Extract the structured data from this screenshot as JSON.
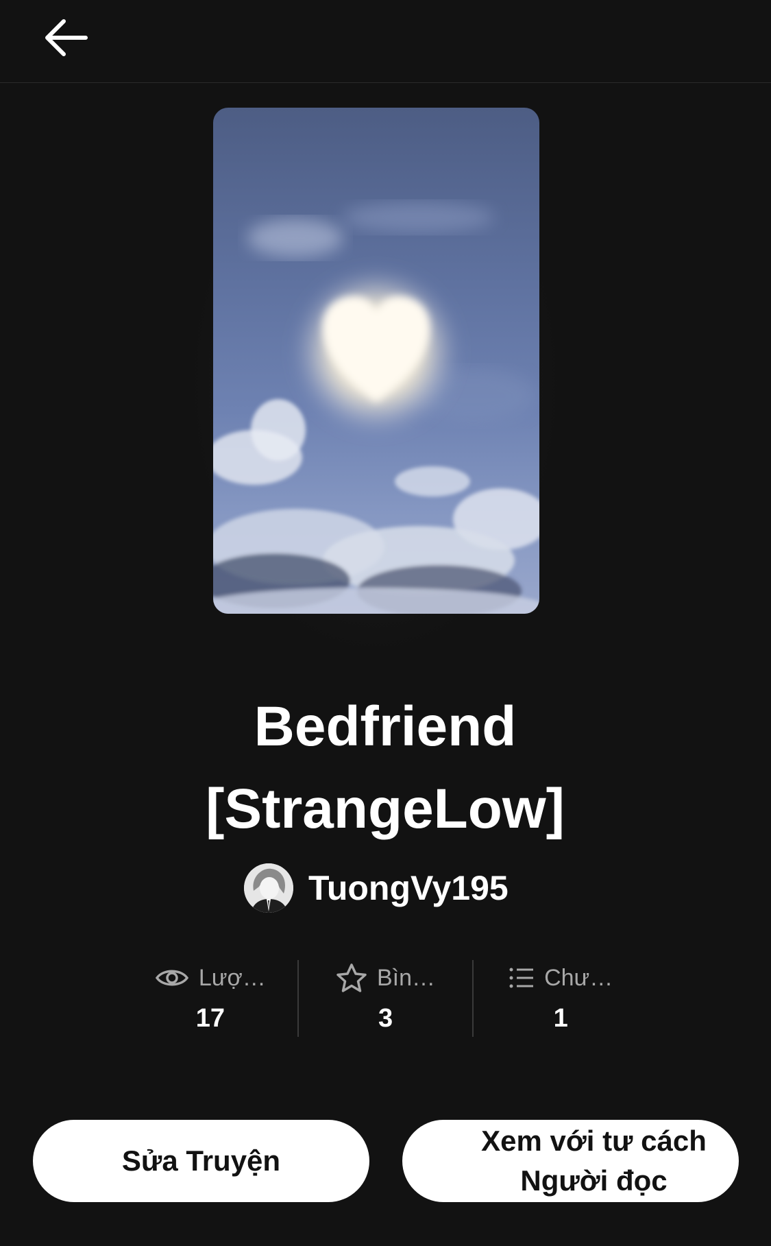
{
  "header": {
    "back_icon": "arrow-left-icon"
  },
  "cover": {
    "image": "heart-shaped-sun-in-cloudy-sky"
  },
  "story": {
    "title": "Bedfriend [StrangeLow]"
  },
  "author": {
    "name": "TuongVy195",
    "avatar": "anime-character-avatar"
  },
  "stats": [
    {
      "icon": "eye-icon",
      "label": "Lượ…",
      "value": "17"
    },
    {
      "icon": "star-icon",
      "label": "Bìn…",
      "value": "3"
    },
    {
      "icon": "list-icon",
      "label": "Chư…",
      "value": "1"
    }
  ],
  "actions": {
    "edit_label": "Sửa Truyện",
    "reader_label": "Xem với tư cách Người đọc"
  },
  "colors": {
    "background": "#121212",
    "text": "#ffffff",
    "muted": "#a8a8a8",
    "button_bg": "#ffffff",
    "button_text": "#121212"
  }
}
